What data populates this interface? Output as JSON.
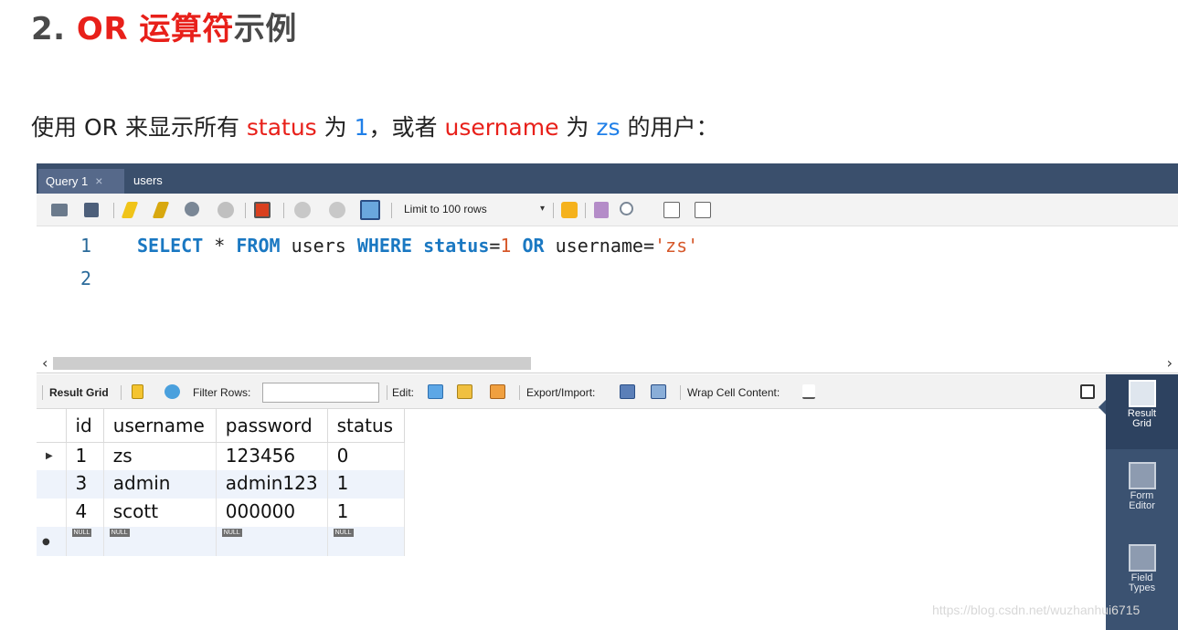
{
  "heading": {
    "prefix": "2. ",
    "red": "OR 运算符",
    "suffix": "示例"
  },
  "description": {
    "p1": "使用 OR 来显示所有 ",
    "kw1": "status",
    "p2": " 为 ",
    "v1": "1",
    "p3": "，或者 ",
    "kw2": "username",
    "p4": " 为 ",
    "v2": "zs",
    "p5": " 的用户："
  },
  "tabs": [
    {
      "label": "Query 1",
      "close": "×"
    },
    {
      "label": "users"
    }
  ],
  "toolbar": {
    "limit_select": "Limit to 100 rows"
  },
  "editor": {
    "line_numbers": [
      "1",
      "2"
    ],
    "sql": {
      "k1": "SELECT",
      "t1": " * ",
      "k2": "FROM",
      "t2": " users ",
      "k3": "WHERE",
      "t3": " ",
      "k4": "status",
      "t4": "=",
      "n1": "1",
      "t5": " ",
      "k5": "OR",
      "t6": " username=",
      "s1": "'zs'"
    }
  },
  "result_toolbar": {
    "result_grid": "Result Grid",
    "filter_rows": "Filter Rows:",
    "edit": "Edit:",
    "export_import": "Export/Import:",
    "wrap_cell": "Wrap Cell Content:"
  },
  "grid": {
    "columns": [
      "id",
      "username",
      "password",
      "status"
    ],
    "rows": [
      [
        "1",
        "zs",
        "123456",
        "0"
      ],
      [
        "3",
        "admin",
        "admin123",
        "1"
      ],
      [
        "4",
        "scott",
        "000000",
        "1"
      ]
    ],
    "null_label": "NULL"
  },
  "sidebar": {
    "result_grid": [
      "Result",
      "Grid"
    ],
    "form_editor": [
      "Form",
      "Editor"
    ],
    "field_types": [
      "Field",
      "Types"
    ]
  },
  "watermark": "https://blog.csdn.net/wuzhanhui6715",
  "colors": {
    "accent_red": "#e8201a",
    "accent_blue": "#1f7fe8",
    "tab_bar": "#3a4f6c",
    "sidebar": "#3b5271"
  }
}
